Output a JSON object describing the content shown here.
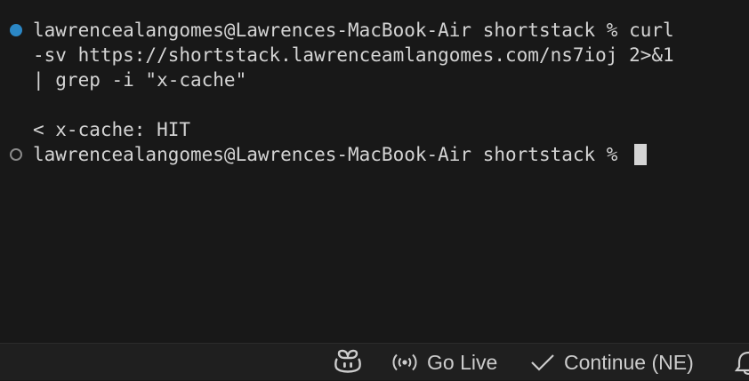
{
  "terminal": {
    "command_prompt_line_1": "lawrencealangomes@Lawrences-MacBook-Air shortstack % curl",
    "command_line_2": "-sv https://shortstack.lawrenceamlangomes.com/ns7ioj 2>&1",
    "command_line_3": "| grep -i \"x-cache\"",
    "output_line": "< x-cache: HIT",
    "current_prompt": "lawrencealangomes@Lawrences-MacBook-Air shortstack % "
  },
  "statusbar": {
    "copilot_icon": "copilot-icon",
    "go_live_icon": "broadcast-icon",
    "go_live_label": "Go Live",
    "continue_icon": "check-icon",
    "continue_label": "Continue (NE)",
    "notifications_icon": "bell-icon"
  },
  "colors": {
    "background": "#181818",
    "text": "#d4d4d4",
    "success_marker": "#2b87c5",
    "idle_marker": "#8a8a8a",
    "statusbar_bg": "#1f1f1f"
  }
}
